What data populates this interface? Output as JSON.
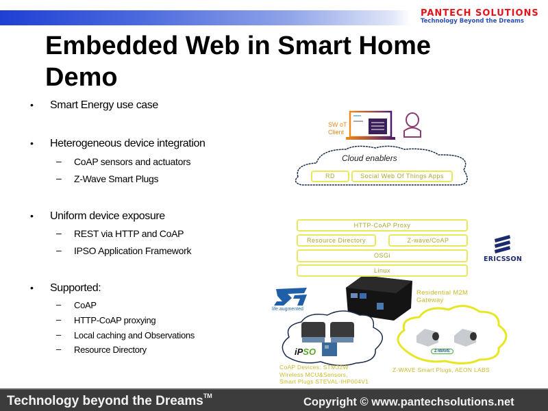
{
  "header": {
    "brand": "PANTECH SOLUTIONS",
    "brand_tagline": "Technology Beyond the Dreams",
    "band_color": "#1f3fd4",
    "brand_color": "#e3141b",
    "tagline_color": "#2b4fb3"
  },
  "slide": {
    "title": "Embedded Web in Smart Home Demo",
    "bullets": [
      {
        "text": "Smart Energy use case",
        "sub": []
      },
      {
        "text": "Heterogeneous device integration",
        "sub": [
          "CoAP sensors and actuators",
          "Z-Wave Smart Plugs"
        ]
      },
      {
        "text": "Uniform device exposure",
        "sub": [
          "REST via HTTP and CoAP",
          "IPSO Application Framework"
        ]
      },
      {
        "text": "Supported:",
        "sub": [
          "CoAP",
          "HTTP-CoAP proxying",
          "Local caching and Observations",
          "Resource Directory"
        ]
      }
    ],
    "bullet_glyph": "•",
    "dash_glyph": "–"
  },
  "diagram": {
    "client_label": "SW oT\nClient",
    "client_line1": "SW oT",
    "client_line2": "Client",
    "cloud_title": "Cloud enablers",
    "cloud_boxes": [
      "RD",
      "Social Web Of Things Apps"
    ],
    "stack": {
      "proxy": "HTTP-CoAP Proxy",
      "resource_directory": "Resource Directory",
      "zwave_coap": "Z-wave/CoAP",
      "osgi": "OSGi",
      "linux": "Linux"
    },
    "gateway_line1": "Residential M2M",
    "gateway_line2": "Gateway",
    "coap_devices": [
      "CoAP Devices: STM32W",
      "Wireless MCU&Sensors,",
      "Smart Plugs STEVAL-IHP004V1"
    ],
    "zwave_caption": "Z-WAVE Smart Plugs, AEON LABS",
    "zwave_logo": "Z-WAVE",
    "ipso_logo": "IPSO",
    "st_tagline": "life.augmented",
    "ericsson": "ERICSSON",
    "accent_yellow": "#e8e85a",
    "label_yellow": "#c9b92a"
  },
  "footer": {
    "left": "Technology beyond the Dreams",
    "left_tm": "TM",
    "right": "Copyright © www.pantechsolutions.net",
    "bg": "#3c3c3c"
  }
}
